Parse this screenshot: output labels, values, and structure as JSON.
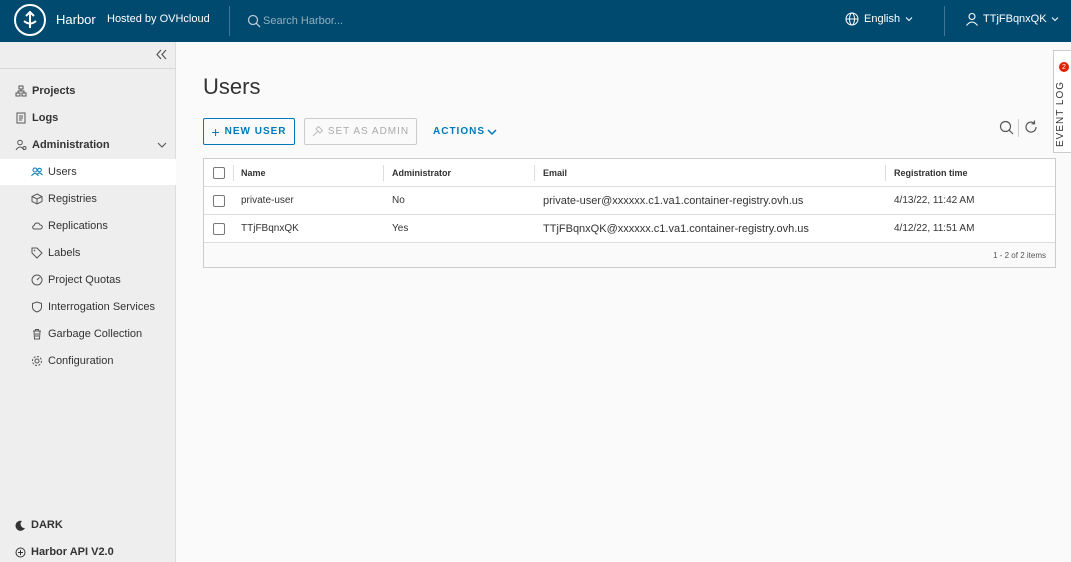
{
  "header": {
    "brand": "Harbor",
    "brand_sub": "Hosted by OVHcloud",
    "search_placeholder": "Search Harbor...",
    "language": "English",
    "username": "TTjFBqnxQK"
  },
  "sidebar": {
    "items": [
      {
        "label": "Projects"
      },
      {
        "label": "Logs"
      },
      {
        "label": "Administration"
      }
    ],
    "admin_items": [
      {
        "label": "Users"
      },
      {
        "label": "Registries"
      },
      {
        "label": "Replications"
      },
      {
        "label": "Labels"
      },
      {
        "label": "Project Quotas"
      },
      {
        "label": "Interrogation Services"
      },
      {
        "label": "Garbage Collection"
      },
      {
        "label": "Configuration"
      }
    ],
    "theme_label": "DARK",
    "api_label": "Harbor API V2.0"
  },
  "main": {
    "title": "Users",
    "new_user_label": "NEW USER",
    "set_admin_label": "SET AS ADMIN",
    "actions_label": "ACTIONS",
    "columns": [
      "Name",
      "Administrator",
      "Email",
      "Registration time"
    ],
    "rows": [
      {
        "name": "private-user",
        "admin": "No",
        "email": "private-user@xxxxxx.c1.va1.container-registry.ovh.us",
        "registered": "4/13/22, 11:42 AM"
      },
      {
        "name": "TTjFBqnxQK",
        "admin": "Yes",
        "email": "TTjFBqnxQK@xxxxxx.c1.va1.container-registry.ovh.us",
        "registered": "4/12/22, 11:51 AM"
      }
    ],
    "footer": "1 - 2 of 2 items"
  },
  "event_log": {
    "label": "EVENT LOG",
    "count": "2"
  },
  "colors": {
    "header_bg": "#004a70",
    "accent": "#0079b8",
    "badge": "#e02200"
  }
}
